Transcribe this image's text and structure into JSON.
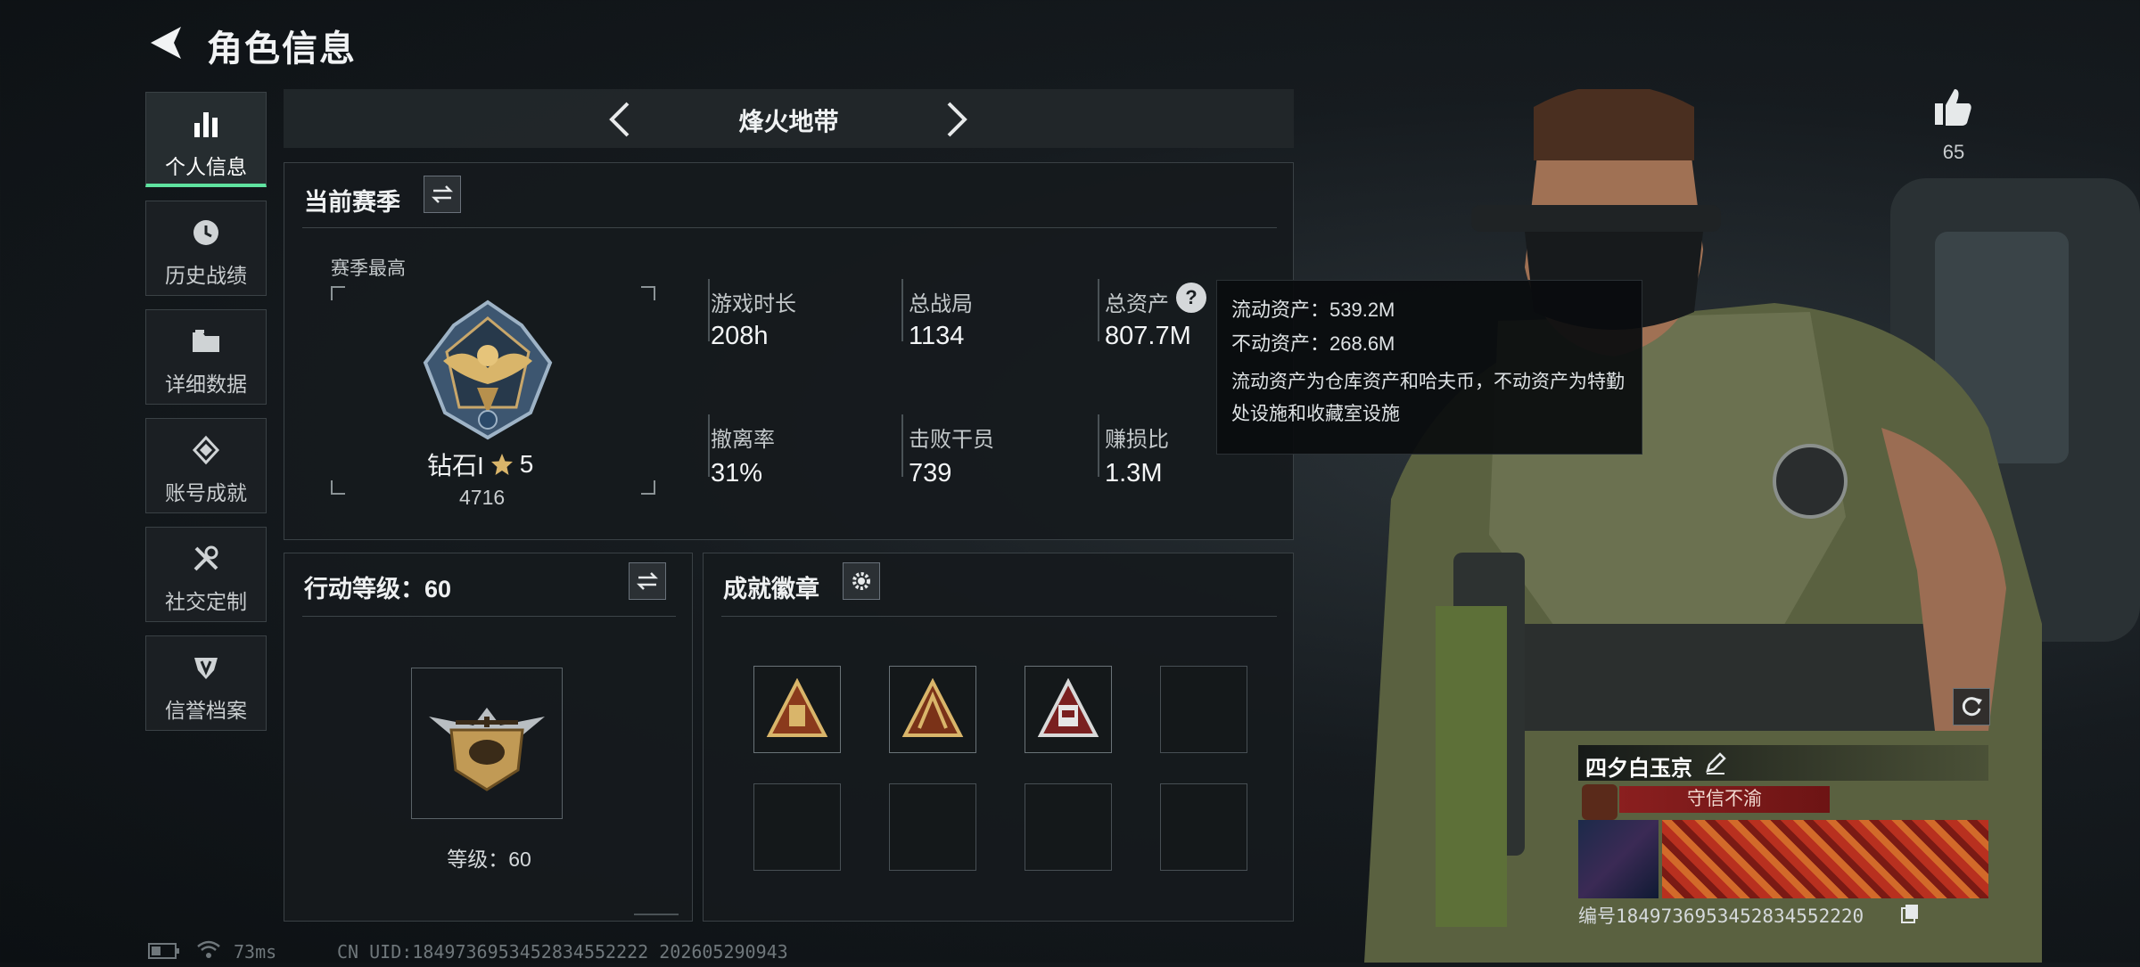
{
  "header": {
    "title": "角色信息"
  },
  "sidebar": {
    "items": [
      {
        "label": "个人信息",
        "icon": "bar-chart-icon",
        "active": true
      },
      {
        "label": "历史战绩",
        "icon": "clock-icon",
        "active": false
      },
      {
        "label": "详细数据",
        "icon": "folder-icon",
        "active": false
      },
      {
        "label": "账号成就",
        "icon": "achievement-icon",
        "active": false
      },
      {
        "label": "社交定制",
        "icon": "tools-icon",
        "active": false
      },
      {
        "label": "信誉档案",
        "icon": "shield-badge-icon",
        "active": false
      }
    ]
  },
  "mode": {
    "title": "烽火地带"
  },
  "season": {
    "title": "当前赛季",
    "best_label": "赛季最高",
    "rank_name": "钻石I",
    "rank_stars": "5",
    "rank_score": "4716",
    "stats": [
      {
        "label": "游戏时长",
        "value": "208h"
      },
      {
        "label": "总战局",
        "value": "1134"
      },
      {
        "label": "总资产",
        "value": "807.7M"
      },
      {
        "label": "撤离率",
        "value": "31%"
      },
      {
        "label": "击败干员",
        "value": "739"
      },
      {
        "label": "赚损比",
        "value": "1.3M"
      }
    ]
  },
  "tooltip": {
    "liquid": "流动资产：539.2M",
    "fixed": "不动资产：268.6M",
    "desc": "流动资产为仓库资产和哈夫币，不动资产为特勤处设施和收藏室设施"
  },
  "action_level": {
    "title": "行动等级：60",
    "level_label": "等级：60"
  },
  "achievements": {
    "title": "成就徽章",
    "filled_count": 3,
    "total_slots": 8
  },
  "profile": {
    "likes": "65",
    "name": "四夕白玉京",
    "motto": "守信不渝",
    "id_line": "编号1849736953452834552220"
  },
  "footer": {
    "ping": "73ms",
    "uid": "CN UID:1849736953452834552222 202605290943"
  },
  "colors": {
    "accent": "#5fe3a0",
    "motto_bg": "#8a1f1f",
    "gold": "#d9b56a"
  }
}
